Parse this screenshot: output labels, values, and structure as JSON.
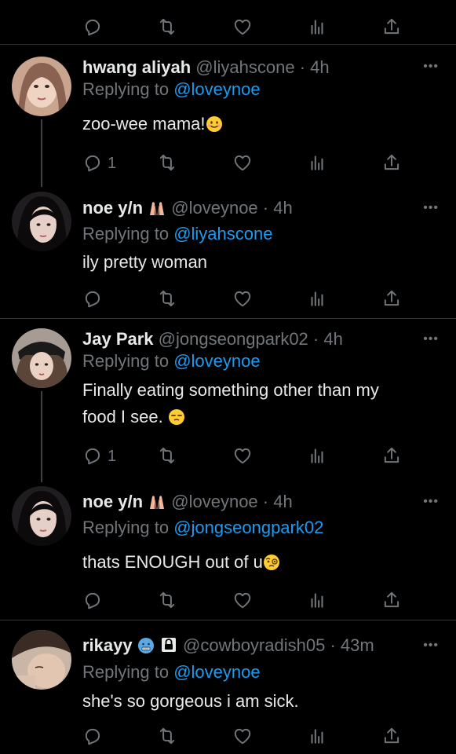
{
  "colors": {
    "background": "#000000",
    "text": "#e7e9ea",
    "muted": "#71767b",
    "link": "#1d9bf0",
    "divider": "#2f3336"
  },
  "more_label": "•••",
  "tweets": [
    {
      "name": "hwang aliyah",
      "handle": "@liyahscone",
      "time": "· 4h",
      "replying_prefix": "Replying to",
      "replying_to": "@loveynoe",
      "text": "zoo-wee mama!",
      "emoji": "smiling-face",
      "reply_count": "1"
    },
    {
      "name": "noe y/n",
      "badge": "hands-emoji",
      "handle": "@loveynoe",
      "time": "· 4h",
      "replying_prefix": "Replying to",
      "replying_to": "@liyahscone",
      "text": "ily pretty woman",
      "reply_count": ""
    },
    {
      "name": "Jay Park",
      "handle": "@jongseongpark02",
      "time": "· 4h",
      "replying_prefix": "Replying to",
      "replying_to": "@loveynoe",
      "text_line1": "Finally eating something other than my",
      "text_line2": "food I see.",
      "emoji": "unamused-face",
      "reply_count": "1"
    },
    {
      "name": "noe y/n",
      "badge": "hands-emoji",
      "handle": "@loveynoe",
      "time": "· 4h",
      "replying_prefix": "Replying to",
      "replying_to": "@jongseongpark02",
      "text": "thats ENOUGH out of u",
      "emoji": "face-with-monocle",
      "reply_count": ""
    },
    {
      "name": "rikayy",
      "badge": "cold-face-emoji",
      "protected": "lock-icon",
      "handle": "@cowboyradish05",
      "time": "· 43m",
      "replying_prefix": "Replying to",
      "replying_to": "@loveynoe",
      "text": "she's so gorgeous i am sick.",
      "reply_count": ""
    }
  ]
}
